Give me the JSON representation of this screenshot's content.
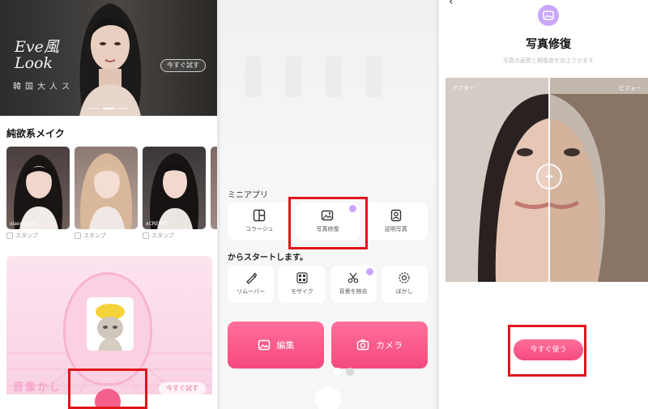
{
  "panel1": {
    "hero": {
      "title": "Eve風\nLook",
      "subtitle": "韓国大人ス",
      "try_button": "今すぐ試す"
    },
    "section_title": "純欲系メイク",
    "cards": [
      {
        "user": "xiaorangka",
        "tag": "スタンプ"
      },
      {
        "user": "",
        "tag": "スタンプ"
      },
      {
        "user": "xCRENKE",
        "tag": "スタンプ"
      }
    ],
    "promo": {
      "text": "音像かし",
      "button": "今すぐ試す"
    }
  },
  "panel2": {
    "mini_apps_title": "ミニアプリ",
    "mini_apps": [
      {
        "label": "コラージュ",
        "icon": "collage-icon"
      },
      {
        "label": "写真修復",
        "icon": "photo-restore-icon"
      },
      {
        "label": "証明写真",
        "icon": "id-photo-icon"
      }
    ],
    "start_title": "からスタートします。",
    "tools": [
      {
        "label": "リムーバー",
        "icon": "remover-icon"
      },
      {
        "label": "モザイク",
        "icon": "mosaic-icon"
      },
      {
        "label": "背景を除去",
        "icon": "background-remove-icon"
      },
      {
        "label": "ぼかし",
        "icon": "blur-icon"
      }
    ],
    "edit_button": "編集",
    "camera_button": "カメラ"
  },
  "panel3": {
    "title": "写真修復",
    "subtitle": "写真の画質と解像度を向上させます",
    "after_label": "アフター",
    "before_label": "ビフォー",
    "use_button": "今すぐ使う"
  },
  "colors": {
    "accent_pink": "#f44a7e",
    "gem_purple": "#c9a6ff",
    "highlight_red": "#e1141b"
  }
}
